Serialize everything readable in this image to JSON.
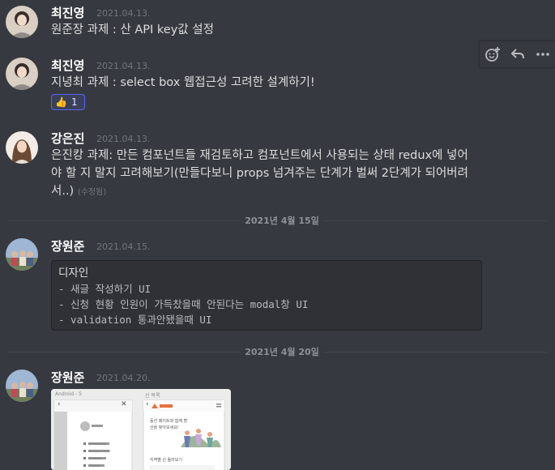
{
  "messages": [
    {
      "username": "최진영",
      "timestamp": "2021.04.13.",
      "text": "원준장 과제 : 산 API key값 설정"
    },
    {
      "username": "최진영",
      "timestamp": "2021.04.13.",
      "text": "지녕최 과제 : select box 웹접근성 고려한 설계하기!",
      "reaction": {
        "emoji": "👍",
        "count": "1"
      }
    },
    {
      "username": "강은진",
      "timestamp": "2021.04.13.",
      "lines": [
        "은진캉 과제: 만든 컴포넌트들 재검토하고 컴포넌트에서 사용되는 상태 redux에 넣어",
        "야 할 지 말지 고려해보기(만들다보니 props 넘겨주는 단계가 벌써 2단계가 되어버려",
        "서..)"
      ],
      "edited": "(수정됨)"
    },
    {
      "username": "장원준",
      "timestamp": "2021.04.15.",
      "code": [
        "디자인",
        "- 새글 작성하기 UI",
        "- 신청 현황 인원이 가득찼을때 안된다는 modal창 UI",
        "- validation 통과안됐을때 UI"
      ]
    },
    {
      "username": "장원준",
      "timestamp": "2021.04.20.",
      "attachment": {
        "left_label": "Android - 5",
        "right_label": "신 목록",
        "menu": [
          "MY REVIEWS",
          "PRODUCT POST",
          "REVIEWS",
          "ORDERS"
        ],
        "right_text": [
          "동선 메이트와 함께 할",
          "산을 찾아보세요!",
          "지역별 산 둘러보기"
        ]
      }
    }
  ],
  "dividers": [
    "2021년 4월 15일",
    "2021년 4월 20일"
  ],
  "toolbar": {
    "icons": [
      "add-reaction-icon",
      "reply-icon",
      "more-icon"
    ]
  },
  "colors": {
    "background": "#36393f",
    "username": "#ffffff",
    "timestamp": "#72767d",
    "reaction_border": "#5865f2"
  }
}
